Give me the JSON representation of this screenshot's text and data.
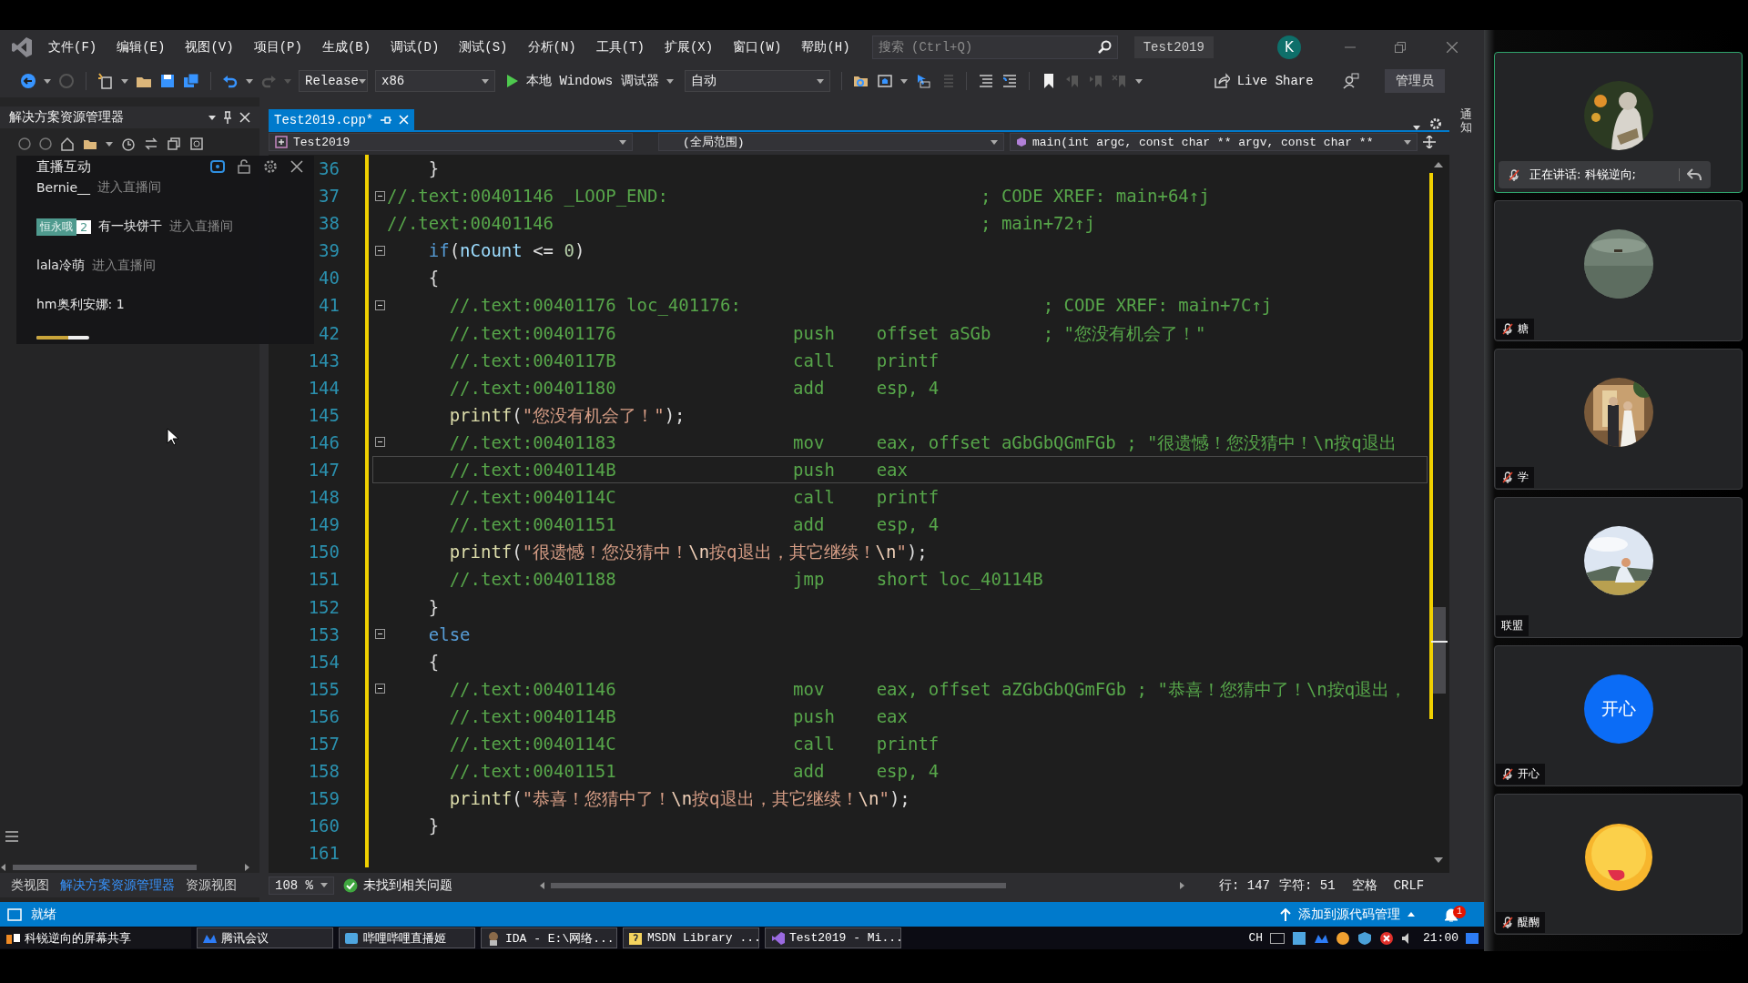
{
  "menu": {
    "items": [
      "文件(F)",
      "编辑(E)",
      "视图(V)",
      "项目(P)",
      "生成(B)",
      "调试(D)",
      "测试(S)",
      "分析(N)",
      "工具(T)",
      "扩展(X)",
      "窗口(W)",
      "帮助(H)"
    ],
    "search": {
      "placeholder": "搜索 (Ctrl+Q)"
    },
    "solution_name": "Test2019",
    "account": "K"
  },
  "toolbar": {
    "configuration": "Release",
    "platform": "x86",
    "debugger": "本地 Windows 调试器",
    "target": "自动",
    "live_share": "Live Share",
    "admin": "管理员"
  },
  "explorer": {
    "title": "解决方案资源管理器",
    "tabs": [
      {
        "label": "类视图",
        "selected": false
      },
      {
        "label": "解决方案资源管理器",
        "selected": true
      },
      {
        "label": "资源视图",
        "selected": false
      }
    ]
  },
  "live_chat": {
    "title": "直播互动",
    "messages": [
      {
        "kind": "enter",
        "user": "Bernie__",
        "action": "进入直播间"
      },
      {
        "kind": "enter",
        "badge": "恒永哦",
        "badge_rank": "2",
        "user": "有一块饼干",
        "action": "进入直播间"
      },
      {
        "kind": "enter",
        "user": "lala冷萌",
        "action": "进入直播间"
      },
      {
        "kind": "chat",
        "text": "hm奥利安娜: 1"
      }
    ],
    "progress": {
      "level": 0.6
    }
  },
  "editor": {
    "tab": {
      "label": "Test2019.cpp*",
      "selected": true
    },
    "nav": {
      "project": "Test2019",
      "scope": "(全局范围)",
      "member": "main(int argc, const char ** argv, const char **"
    },
    "lines": [
      {
        "number": "36",
        "fold": false,
        "selected": false,
        "parts": [
          {
            "kind": "plain",
            "text": "    }"
          }
        ]
      },
      {
        "number": "37",
        "fold": true,
        "selected": false,
        "parts": [
          {
            "kind": "comment",
            "text": "//.text:00401146 _LOOP_END:                              ; CODE XREF: main+64↑j"
          }
        ]
      },
      {
        "number": "38",
        "fold": false,
        "selected": false,
        "parts": [
          {
            "kind": "comment",
            "text": "//.text:00401146                                         ; main+72↑j"
          }
        ]
      },
      {
        "number": "39",
        "fold": true,
        "selected": false,
        "parts": [
          {
            "kind": "keyword",
            "text": "    if"
          },
          {
            "kind": "plain",
            "text": "("
          },
          {
            "kind": "var",
            "text": "nCount"
          },
          {
            "kind": "plain",
            "text": " <= "
          },
          {
            "kind": "number",
            "text": "0"
          },
          {
            "kind": "plain",
            "text": ")"
          }
        ]
      },
      {
        "number": "40",
        "fold": false,
        "selected": false,
        "parts": [
          {
            "kind": "plain",
            "text": "    {"
          }
        ]
      },
      {
        "number": "41",
        "fold": true,
        "selected": false,
        "parts": [
          {
            "kind": "comment",
            "text": "      //.text:00401176 loc_401176:                             ; CODE XREF: main+7C↑j"
          }
        ]
      },
      {
        "number": "42",
        "fold": false,
        "selected": false,
        "parts": [
          {
            "kind": "comment",
            "text": "      //.text:00401176                 push    offset aSGb     ; \"您没有机会了！\""
          }
        ]
      },
      {
        "number": "143",
        "fold": false,
        "selected": false,
        "parts": [
          {
            "kind": "comment",
            "text": "      //.text:0040117B                 call    printf"
          }
        ]
      },
      {
        "number": "144",
        "fold": false,
        "selected": false,
        "parts": [
          {
            "kind": "comment",
            "text": "      //.text:00401180                 add     esp, 4"
          }
        ]
      },
      {
        "number": "145",
        "fold": false,
        "selected": false,
        "parts": [
          {
            "kind": "func",
            "text": "      printf"
          },
          {
            "kind": "plain",
            "text": "("
          },
          {
            "kind": "string",
            "text": "\"您没有机会了！\""
          },
          {
            "kind": "plain",
            "text": ");"
          }
        ]
      },
      {
        "number": "146",
        "fold": true,
        "selected": false,
        "parts": [
          {
            "kind": "comment",
            "text": "      //.text:00401183                 mov     eax, offset aGbGbQGmFGb ; \"很遗憾！您没猜中！\\n按q退出"
          }
        ]
      },
      {
        "number": "147",
        "fold": false,
        "selected": true,
        "parts": [
          {
            "kind": "comment",
            "text": "      //.text:0040114B                 push    eax"
          }
        ]
      },
      {
        "number": "148",
        "fold": false,
        "selected": false,
        "parts": [
          {
            "kind": "comment",
            "text": "      //.text:0040114C                 call    printf"
          }
        ]
      },
      {
        "number": "149",
        "fold": false,
        "selected": false,
        "parts": [
          {
            "kind": "comment",
            "text": "      //.text:00401151                 add     esp, 4"
          }
        ]
      },
      {
        "number": "150",
        "fold": false,
        "selected": false,
        "parts": [
          {
            "kind": "func",
            "text": "      printf"
          },
          {
            "kind": "plain",
            "text": "("
          },
          {
            "kind": "string",
            "text": "\"很遗憾！您没猜中！"
          },
          {
            "kind": "escape",
            "text": "\\n"
          },
          {
            "kind": "string",
            "text": "按q退出，其它继续！"
          },
          {
            "kind": "escape",
            "text": "\\n"
          },
          {
            "kind": "string",
            "text": "\""
          },
          {
            "kind": "plain",
            "text": ");"
          }
        ]
      },
      {
        "number": "151",
        "fold": false,
        "selected": false,
        "parts": [
          {
            "kind": "comment",
            "text": "      //.text:00401188                 jmp     short loc_40114B"
          }
        ]
      },
      {
        "number": "152",
        "fold": false,
        "selected": false,
        "parts": [
          {
            "kind": "plain",
            "text": "    }"
          }
        ]
      },
      {
        "number": "153",
        "fold": true,
        "selected": false,
        "parts": [
          {
            "kind": "keyword",
            "text": "    else"
          }
        ]
      },
      {
        "number": "154",
        "fold": false,
        "selected": false,
        "parts": [
          {
            "kind": "plain",
            "text": "    {"
          }
        ]
      },
      {
        "number": "155",
        "fold": true,
        "selected": false,
        "parts": [
          {
            "kind": "comment",
            "text": "      //.text:00401146                 mov     eax, offset aZGbGbQGmFGb ; \"恭喜！您猜中了！\\n按q退出，"
          }
        ]
      },
      {
        "number": "156",
        "fold": false,
        "selected": false,
        "parts": [
          {
            "kind": "comment",
            "text": "      //.text:0040114B                 push    eax"
          }
        ]
      },
      {
        "number": "157",
        "fold": false,
        "selected": false,
        "parts": [
          {
            "kind": "comment",
            "text": "      //.text:0040114C                 call    printf"
          }
        ]
      },
      {
        "number": "158",
        "fold": false,
        "selected": false,
        "parts": [
          {
            "kind": "comment",
            "text": "      //.text:00401151                 add     esp, 4"
          }
        ]
      },
      {
        "number": "159",
        "fold": false,
        "selected": false,
        "parts": [
          {
            "kind": "func",
            "text": "      printf"
          },
          {
            "kind": "plain",
            "text": "("
          },
          {
            "kind": "string",
            "text": "\"恭喜！您猜中了！"
          },
          {
            "kind": "escape",
            "text": "\\n"
          },
          {
            "kind": "string",
            "text": "按q退出，其它继续！"
          },
          {
            "kind": "escape",
            "text": "\\n"
          },
          {
            "kind": "string",
            "text": "\""
          },
          {
            "kind": "plain",
            "text": ");"
          }
        ]
      },
      {
        "number": "160",
        "fold": false,
        "selected": false,
        "parts": [
          {
            "kind": "plain",
            "text": "    }"
          }
        ]
      },
      {
        "number": "161",
        "fold": false,
        "selected": false
      }
    ],
    "zoom": "108 %",
    "issues": "未找到相关问题",
    "cursor_line": "行: 147",
    "cursor_column": "字符: 51",
    "whitespace": "空格",
    "line_ending": "CRLF"
  },
  "side_tab": "通知",
  "status": {
    "text": "就绪",
    "source_control": "添加到源代码管理",
    "notifications": "1"
  },
  "taskbar": {
    "items": [
      "科锐逆向的屏幕共享",
      "腾讯会议",
      "哔哩哔哩直播姬",
      "IDA - E:\\网络...",
      "MSDN Library ...",
      "Test2019 - Mi..."
    ],
    "language": "CH",
    "clock": "21:00"
  },
  "meeting": {
    "participants": [
      {
        "kind": "picture",
        "selected": true,
        "muted": true,
        "speaking": "正在讲话: 科锐逆向;"
      },
      {
        "kind": "picture",
        "selected": false,
        "muted": true,
        "name": "糖"
      },
      {
        "kind": "picture",
        "selected": false,
        "muted": true,
        "name": "学"
      },
      {
        "kind": "picture",
        "selected": false,
        "muted": false,
        "name": "联盟"
      },
      {
        "kind": "text",
        "selected": false,
        "muted": true,
        "avatar_text": "开心",
        "name": "开心"
      },
      {
        "kind": "emoji",
        "selected": false,
        "muted": true,
        "name": "醍醐"
      }
    ]
  }
}
